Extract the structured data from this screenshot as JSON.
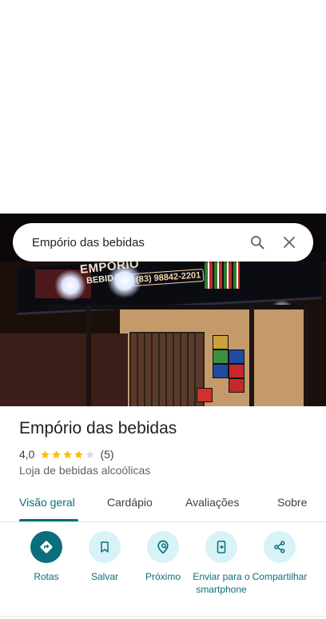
{
  "search": {
    "query": "Empório das bebidas",
    "search_icon": "search-icon",
    "close_icon": "close-icon"
  },
  "photo": {
    "sign_brand": "EMPÓRIO",
    "sign_brand2": "BEBIDAS",
    "sign_phone": "(83) 98842-2201"
  },
  "place": {
    "name": "Empório das bebidas",
    "rating": "4,0",
    "rating_value": 4.0,
    "rating_max": 5,
    "review_count": "(5)",
    "category": "Loja de bebidas alcoólicas",
    "star_color": "#fbbc04"
  },
  "tabs": [
    {
      "label": "Visão geral",
      "active": true
    },
    {
      "label": "Cardápio",
      "active": false
    },
    {
      "label": "Avaliações",
      "active": false
    },
    {
      "label": "Sobre",
      "active": false
    }
  ],
  "actions": [
    {
      "label": "Rotas",
      "icon": "directions-icon"
    },
    {
      "label": "Salvar",
      "icon": "bookmark-icon"
    },
    {
      "label": "Próximo",
      "icon": "nearby-icon"
    },
    {
      "label": "Enviar para o smartphone",
      "icon": "send-to-phone-icon"
    },
    {
      "label": "Compartilhar",
      "icon": "share-icon"
    }
  ],
  "colors": {
    "accent": "#0b6e7a",
    "action_bg": "#d7f3f8"
  }
}
